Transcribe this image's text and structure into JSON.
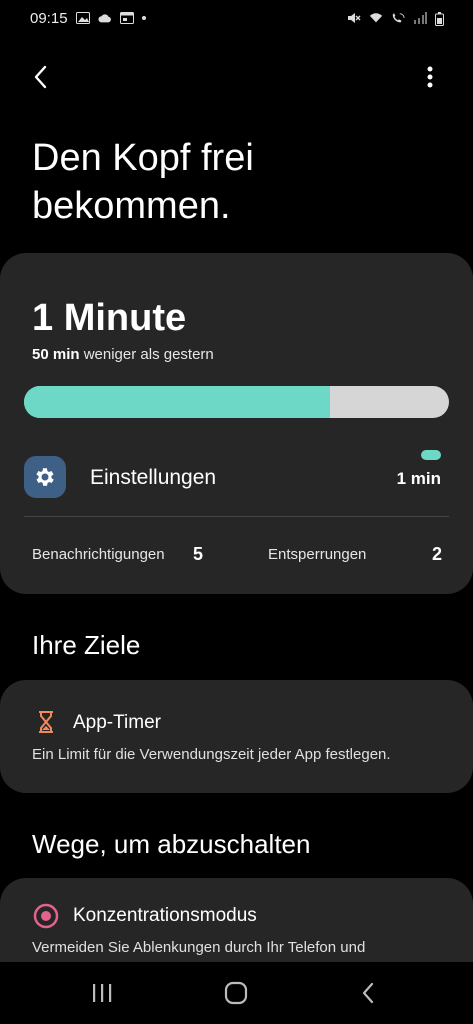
{
  "status_bar": {
    "time": "09:15",
    "left_icons": [
      "image-icon",
      "cloud-icon",
      "calendar-icon",
      "dot-icon"
    ],
    "right_icons": [
      "mute-icon",
      "wifi-icon",
      "wifi-calling-icon",
      "signal-icon",
      "battery-icon"
    ]
  },
  "header": {
    "back_icon": "chevron-left-icon",
    "more_icon": "more-vertical-icon",
    "title": "Den Kopf frei bekommen."
  },
  "usage": {
    "value": "1 Minute",
    "compare_bold": "50 min",
    "compare_text": "weniger als gestern",
    "progress_fraction": 0.72,
    "accent_color": "#6cd8c5",
    "track_color": "#d6d6d6",
    "top_app": {
      "icon": "gear-icon",
      "name": "Einstellungen",
      "time": "1 min"
    },
    "notifications_label": "Benachrichtigungen",
    "notifications_value": "5",
    "unlocks_label": "Entsperrungen",
    "unlocks_value": "2"
  },
  "goals": {
    "section_title": "Ihre Ziele",
    "app_timer": {
      "icon": "hourglass-icon",
      "title": "App-Timer",
      "description": "Ein Limit für die Verwendungszeit jeder App festlegen."
    }
  },
  "ways": {
    "section_title": "Wege, um abzuschalten",
    "focus_mode": {
      "icon": "target-icon",
      "title": "Konzentrationsmodus",
      "description": "Vermeiden Sie Ablenkungen durch Ihr Telefon und"
    }
  },
  "nav": {
    "recents_icon": "recents-icon",
    "home_icon": "home-icon",
    "back_icon": "back-icon"
  }
}
